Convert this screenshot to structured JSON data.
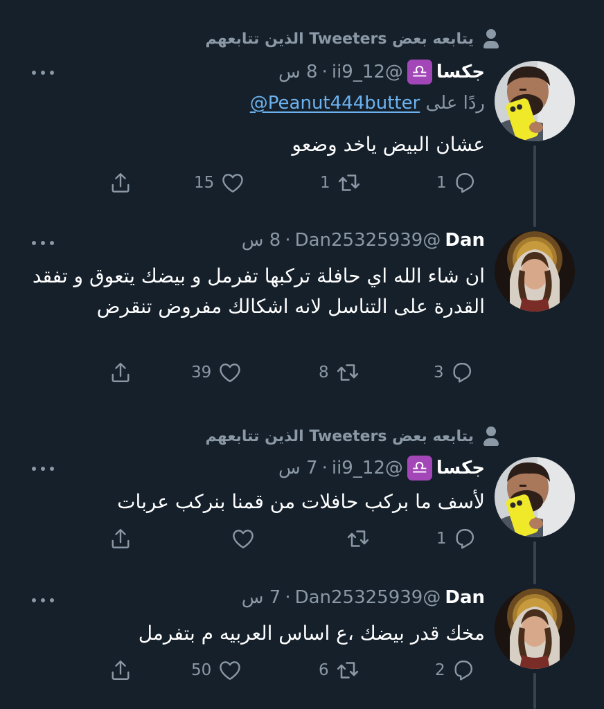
{
  "colors": {
    "background": "#15202b",
    "text": "#ffffff",
    "muted": "#8b98a5",
    "link": "#6cb2ee",
    "thread_line": "#38444d",
    "libra_badge": "#a347b8"
  },
  "social_context": "يتابعه بعض Tweeters الذين تتابعهم",
  "tweets": [
    {
      "name": "جكسا",
      "badge": "♎",
      "handle": "@ii9_12",
      "separator": "·",
      "time": "8 س",
      "reply_to_prefix": "ردًا على",
      "reply_to_handle": "@Peanut444butter",
      "text": "عشان البيض ياخد وضعو",
      "replies": "1",
      "retweets": "1",
      "likes": "15",
      "avatar": "man-yellow-phone"
    },
    {
      "name": "Dan",
      "handle": "@Dan25325939",
      "separator": "·",
      "time": "8 س",
      "text": "ان شاء الله اي حافلة تركبها تفرمل و بيضك يتعوق و تفقد القدرة على التناسل لانه اشكالك مفروض تنقرض",
      "replies": "3",
      "retweets": "8",
      "likes": "39",
      "avatar": "woman-halo-painting"
    },
    {
      "name": "جكسا",
      "badge": "♎",
      "handle": "@ii9_12",
      "separator": "·",
      "time": "7 س",
      "text": "لأسف ما بركب حافلات من قمنا بنركب عربات",
      "replies": "1",
      "retweets": "",
      "likes": "",
      "avatar": "man-yellow-phone"
    },
    {
      "name": "Dan",
      "handle": "@Dan25325939",
      "separator": "·",
      "time": "7 س",
      "text": "مخك قدر بيضك ،ع اساس العربيه م بتفرمل",
      "replies": "2",
      "retweets": "6",
      "likes": "50",
      "avatar": "woman-halo-painting"
    }
  ],
  "icons": {
    "context": "person-icon",
    "reply": "reply-icon",
    "retweet": "retweet-icon",
    "like": "heart-icon",
    "share": "share-icon",
    "more": "more-dots-icon"
  }
}
